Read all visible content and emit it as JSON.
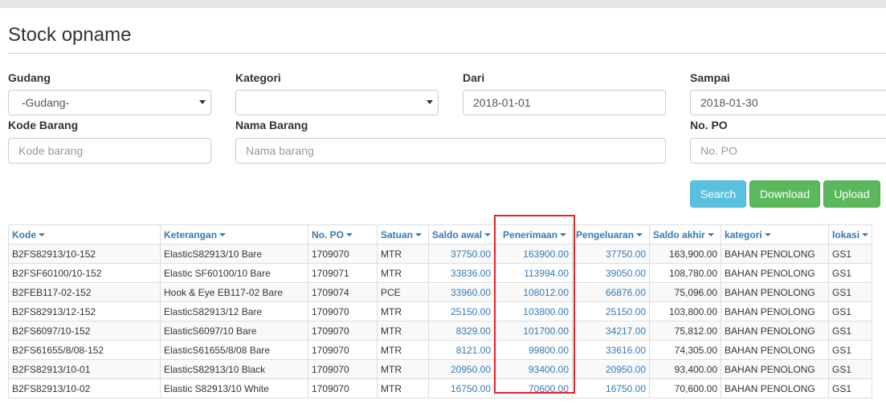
{
  "page": {
    "title": "Stock opname"
  },
  "filters": {
    "gudang": {
      "label": "Gudang",
      "value": "-Gudang-"
    },
    "kategori": {
      "label": "Kategori",
      "value": ""
    },
    "dari": {
      "label": "Dari",
      "value": "2018-01-01"
    },
    "sampai": {
      "label": "Sampai",
      "value": "2018-01-30"
    },
    "kode_barang": {
      "label": "Kode Barang",
      "placeholder": "Kode barang"
    },
    "nama_barang": {
      "label": "Nama Barang",
      "placeholder": "Nama barang"
    },
    "no_po": {
      "label": "No. PO",
      "placeholder": "No. PO"
    }
  },
  "buttons": {
    "search": "Search",
    "download": "Download",
    "upload": "Upload"
  },
  "table": {
    "columns": [
      "Kode",
      "Keterangan",
      "No. PO",
      "Satuan",
      "Saldo awal",
      "Penerimaan",
      "Pengeluaran",
      "Saldo akhir",
      "kategori",
      "lokasi"
    ],
    "rows": [
      [
        "B2FS82913/10-152",
        "ElasticS82913/10 Bare",
        "1709070",
        "MTR",
        "37750.00",
        "163900.00",
        "37750.00",
        "163,900.00",
        "BAHAN PENOLONG",
        "GS1"
      ],
      [
        "B2FSF60100/10-152",
        "Elastic SF60100/10 Bare",
        "1709071",
        "MTR",
        "33836.00",
        "113994.00",
        "39050.00",
        "108,780.00",
        "BAHAN PENOLONG",
        "GS1"
      ],
      [
        "B2FEB117-02-152",
        "Hook & Eye EB117-02 Bare",
        "1709074",
        "PCE",
        "33960.00",
        "108012.00",
        "66876.00",
        "75,096.00",
        "BAHAN PENOLONG",
        "GS1"
      ],
      [
        "B2FS82913/12-152",
        "ElasticS82913/12 Bare",
        "1709070",
        "MTR",
        "25150.00",
        "103800.00",
        "25150.00",
        "103,800.00",
        "BAHAN PENOLONG",
        "GS1"
      ],
      [
        "B2FS6097/10-152",
        "ElasticS6097/10 Bare",
        "1709070",
        "MTR",
        "8329.00",
        "101700.00",
        "34217.00",
        "75,812.00",
        "BAHAN PENOLONG",
        "GS1"
      ],
      [
        "B2FS61655/8/08-152",
        "ElasticS61655/8/08 Bare",
        "1709070",
        "MTR",
        "8121.00",
        "99800.00",
        "33616.00",
        "74,305.00",
        "BAHAN PENOLONG",
        "GS1"
      ],
      [
        "B2FS82913/10-01",
        "ElasticS82913/10 Black",
        "1709070",
        "MTR",
        "20950.00",
        "93400.00",
        "20950.00",
        "93,400.00",
        "BAHAN PENOLONG",
        "GS1"
      ],
      [
        "B2FS82913/10-02",
        "Elastic S82913/10 White",
        "1709070",
        "MTR",
        "16750.00",
        "70600.00",
        "16750.00",
        "70,600.00",
        "BAHAN PENOLONG",
        "GS1"
      ]
    ]
  }
}
